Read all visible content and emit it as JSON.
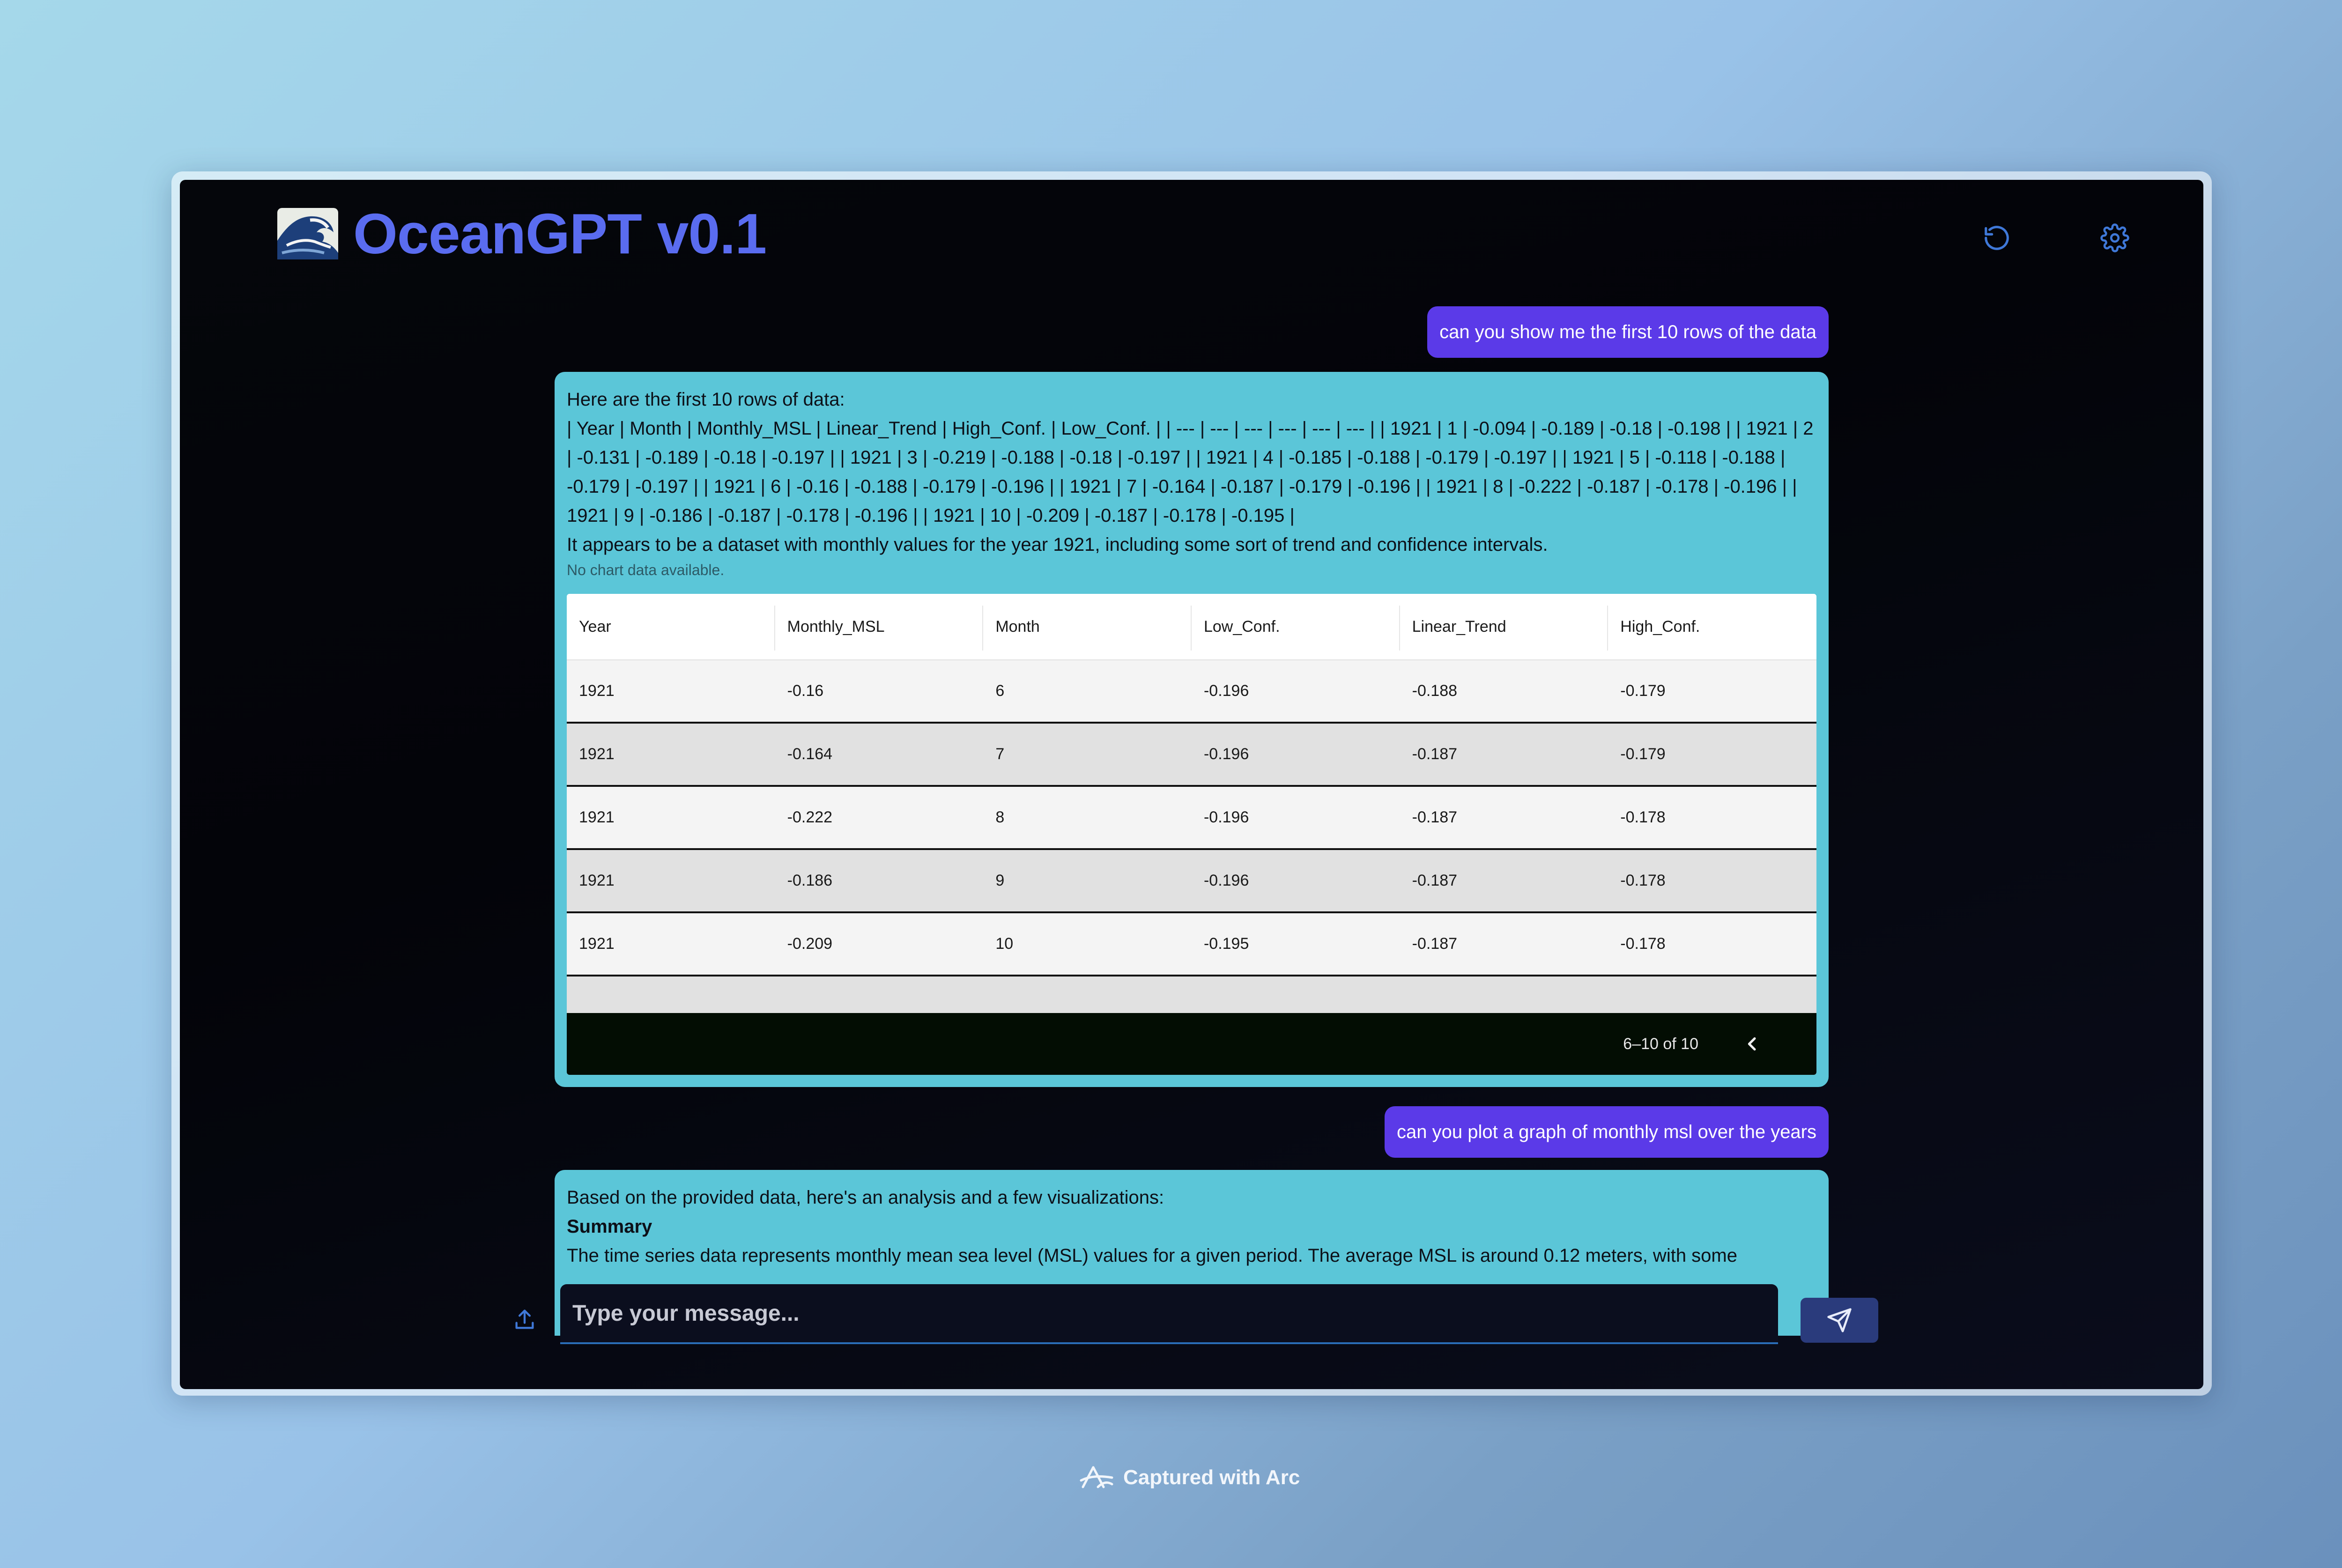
{
  "app": {
    "title": "OceanGPT v0.1",
    "logo_icon": "wave-emoji-icon",
    "refresh_icon": "refresh-icon",
    "settings_icon": "gear-icon",
    "accent": "#5a6cf0"
  },
  "messages": {
    "user1": "can you show me the first 10 rows of the data",
    "bot1": {
      "intro": "Here are the first 10 rows of data:",
      "raw_table": "| Year | Month | Monthly_MSL | Linear_Trend | High_Conf. | Low_Conf. | | --- | --- | --- | --- | --- | --- | | 1921 | 1 | -0.094 | -0.189 | -0.18 | -0.198 | | 1921 | 2 | -0.131 | -0.189 | -0.18 | -0.197 | | 1921 | 3 | -0.219 | -0.188 | -0.18 | -0.197 | | 1921 | 4 | -0.185 | -0.188 | -0.179 | -0.197 | | 1921 | 5 | -0.118 | -0.188 | -0.179 | -0.197 | | 1921 | 6 | -0.16 | -0.188 | -0.179 | -0.196 | | 1921 | 7 | -0.164 | -0.187 | -0.179 | -0.196 | | 1921 | 8 | -0.222 | -0.187 | -0.178 | -0.196 | | 1921 | 9 | -0.186 | -0.187 | -0.178 | -0.196 | | 1921 | 10 | -0.209 | -0.187 | -0.178 | -0.195 |",
      "summary": "It appears to be a dataset with monthly values for the year 1921, including some sort of trend and confidence intervals.",
      "no_chart": "No chart data available.",
      "grid": {
        "columns": [
          "Year",
          "Monthly_MSL",
          "Month",
          "Low_Conf.",
          "Linear_Trend",
          "High_Conf."
        ],
        "rows": [
          [
            "1921",
            "-0.16",
            "6",
            "-0.196",
            "-0.188",
            "-0.179"
          ],
          [
            "1921",
            "-0.164",
            "7",
            "-0.196",
            "-0.187",
            "-0.179"
          ],
          [
            "1921",
            "-0.222",
            "8",
            "-0.196",
            "-0.187",
            "-0.178"
          ],
          [
            "1921",
            "-0.186",
            "9",
            "-0.196",
            "-0.187",
            "-0.178"
          ],
          [
            "1921",
            "-0.209",
            "10",
            "-0.195",
            "-0.187",
            "-0.178"
          ]
        ],
        "pagination": "6–10 of 10",
        "prev_icon": "chevron-left-icon"
      }
    },
    "user2": "can you plot a graph of monthly msl over the years",
    "bot2": {
      "intro": "Based on the provided data, here's an analysis and a few visualizations:",
      "heading": "Summary",
      "body": "The time series data represents monthly mean sea level (MSL) values for a given period. The average MSL is around 0.12 meters, with some"
    }
  },
  "composer": {
    "placeholder": "Type your message...",
    "upload_icon": "upload-icon",
    "send_icon": "send-icon"
  },
  "footer": {
    "credit": "Captured with Arc",
    "credit_icon": "arc-logo-icon"
  }
}
